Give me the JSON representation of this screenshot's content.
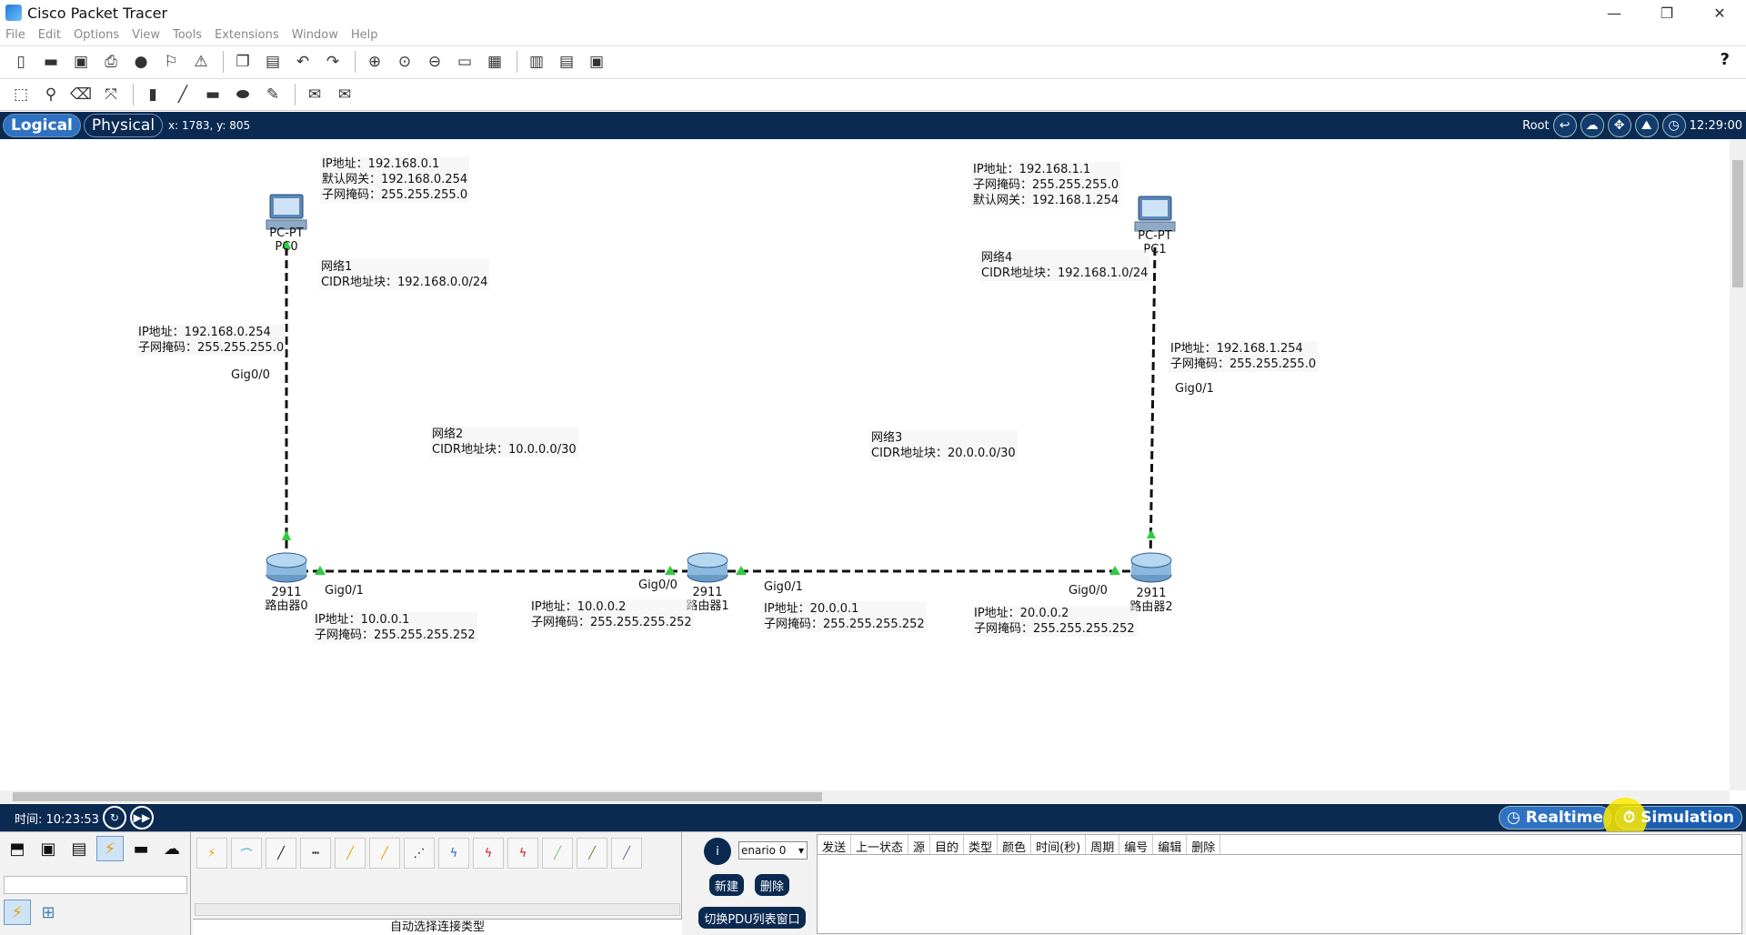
{
  "window": {
    "title": "Cisco Packet Tracer",
    "controls": [
      "—",
      "❐",
      "✕"
    ]
  },
  "menu": [
    "File",
    "Edit",
    "Options",
    "View",
    "Tools",
    "Extensions",
    "Window",
    "Help"
  ],
  "nav": {
    "logical": "Logical",
    "physical": "Physical",
    "coords": "x: 1783, y: 805",
    "root": "Root",
    "clock": "12:29:00"
  },
  "devices": {
    "pc0": {
      "model": "PC-PT",
      "name": "PC0"
    },
    "pc1": {
      "model": "PC-PT",
      "name": "PC1"
    },
    "r0": {
      "model": "2911",
      "name": "路由器0"
    },
    "r1": {
      "model": "2911",
      "name": "路由器1"
    },
    "r2": {
      "model": "2911",
      "name": "路由器2"
    }
  },
  "ports": {
    "r0_g00": "Gig0/0",
    "r0_g01": "Gig0/1",
    "r1_g00": "Gig0/0",
    "r1_g01": "Gig0/1",
    "r2_g00": "Gig0/0",
    "r2_g01": "Gig0/1"
  },
  "notes": {
    "pc0": "IP地址：192.168.0.1\n默认网关：192.168.0.254\n子网掩码：255.255.255.0",
    "pc1": "IP地址：192.168.1.1\n子网掩码：255.255.255.0\n默认网关：192.168.1.254",
    "net1": "网络1\nCIDR地址块：192.168.0.0/24",
    "net4": "网络4\nCIDR地址块：192.168.1.0/24",
    "r0_g00": "IP地址：192.168.0.254\n子网掩码：255.255.255.0",
    "r2_g01": "IP地址：192.168.1.254\n子网掩码：255.255.255.0",
    "net2": "网络2\nCIDR地址块：10.0.0.0/30",
    "net3": "网络3\nCIDR地址块：20.0.0.0/30",
    "r0_g01": "IP地址：10.0.0.1\n子网掩码：255.255.255.252",
    "r1_g00": "IP地址：10.0.0.2\n子网掩码：255.255.255.252",
    "r1_g01": "IP地址：20.0.0.1\n子网掩码：255.255.255.252",
    "r2_g00": "IP地址：20.0.0.2\n子网掩码：255.255.255.252"
  },
  "timebar": {
    "time": "时间: 10:23:53",
    "realtime": "Realtime",
    "simulation": "Simulation"
  },
  "bottom": {
    "conn_status": "自动选择连接类型",
    "scenario": "enario 0",
    "new_btn": "新建",
    "delete_btn": "删除",
    "toggle_pdu_btn": "切换PDU列表窗口",
    "pdu_columns": [
      "发送",
      "上一状态",
      "源",
      "目的",
      "类型",
      "颜色",
      "时间(秒)",
      "周期",
      "编号",
      "编辑",
      "删除"
    ]
  }
}
